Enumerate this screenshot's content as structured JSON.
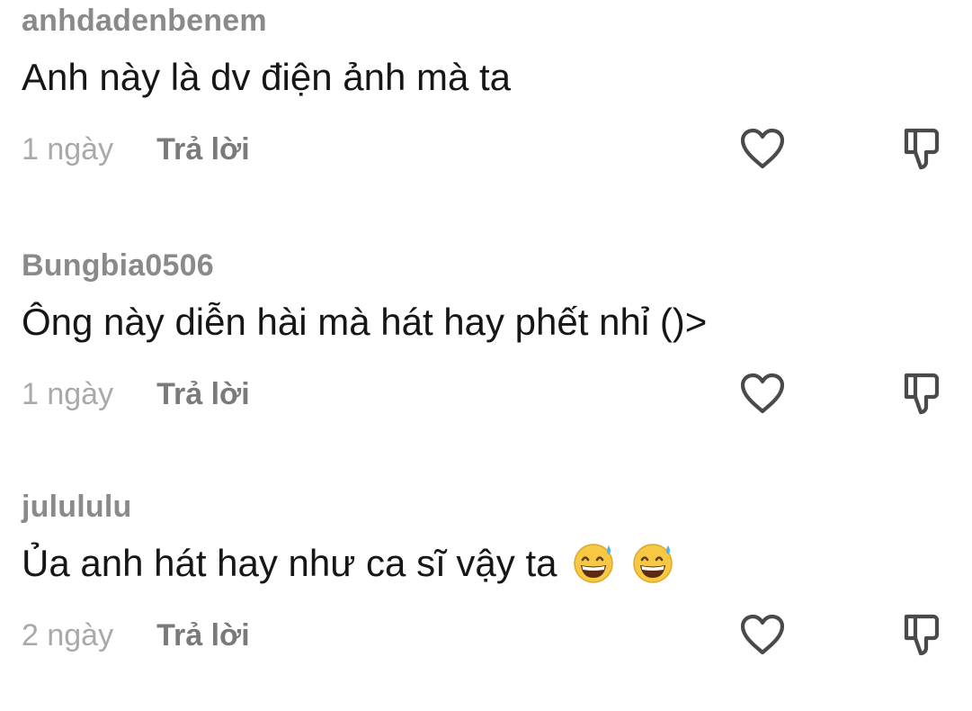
{
  "comments": [
    {
      "username": "anhdadenbenem",
      "text": "Anh này là dv điện ảnh mà ta",
      "time": "1 ngày",
      "reply_label": "Trả lời"
    },
    {
      "username": "Bungbia0506",
      "text": "Ông này diễn hài mà hát hay phết nhỉ ()>",
      "time": "1 ngày",
      "reply_label": "Trả lời"
    },
    {
      "username": "julululu",
      "text": "Ủa anh hát hay như ca sĩ vậy ta",
      "emojis": [
        "grinning-face-with-sweat",
        "grinning-face-with-sweat"
      ],
      "time": "2 ngày",
      "reply_label": "Trả lời"
    }
  ],
  "icons": {
    "like": "heart-outline-icon",
    "dislike": "thumbs-down-outline-icon"
  },
  "colors": {
    "username": "#8a8a8a",
    "text": "#161616",
    "time": "#a9a9a9",
    "reply": "#7a7a7a",
    "icon": "#4a4a4a"
  }
}
